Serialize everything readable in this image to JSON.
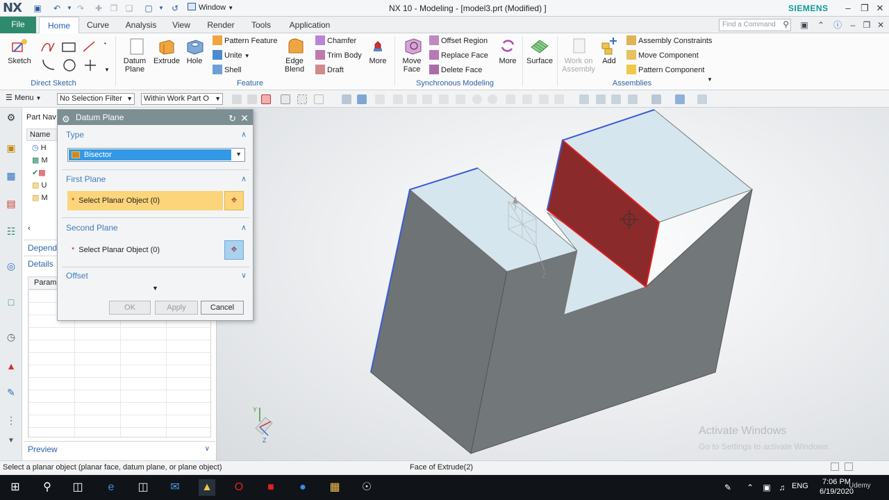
{
  "titlebar": {
    "logo": "NX",
    "window_menu": "Window",
    "title": "NX 10 - Modeling - [model3.prt (Modified) ]",
    "brand": "SIEMENS"
  },
  "tabs": {
    "file": "File",
    "items": [
      "Home",
      "Curve",
      "Analysis",
      "View",
      "Render",
      "Tools",
      "Application"
    ],
    "find_placeholder": "Find a Command"
  },
  "ribbon": {
    "direct_sketch": {
      "label": "Direct Sketch",
      "sketch": "Sketch"
    },
    "feature": {
      "label": "Feature",
      "datum_plane": "Datum Plane",
      "extrude": "Extrude",
      "hole": "Hole",
      "pattern_feature": "Pattern Feature",
      "unite": "Unite",
      "shell": "Shell",
      "edge_blend": "Edge Blend",
      "chamfer": "Chamfer",
      "trim_body": "Trim Body",
      "draft": "Draft",
      "more": "More"
    },
    "sync": {
      "label": "Synchronous Modeling",
      "move_face": "Move Face",
      "offset_region": "Offset Region",
      "replace_face": "Replace Face",
      "delete_face": "Delete Face",
      "more": "More"
    },
    "surface": "Surface",
    "assemblies": {
      "label": "Assemblies",
      "work_on_assembly": "Work on Assembly",
      "add": "Add",
      "assembly_constraints": "Assembly Constraints",
      "move_component": "Move Component",
      "pattern_component": "Pattern Component"
    }
  },
  "selbar": {
    "menu": "Menu",
    "filter": "No Selection Filter",
    "scope": "Within Work Part O"
  },
  "partnav": {
    "title": "Part Nav",
    "header": "Name",
    "rows": [
      "H",
      "M",
      "",
      "U",
      "M"
    ],
    "dependencies": "Depende",
    "details": "Details",
    "param_header": "Param",
    "preview": "Preview"
  },
  "dialog": {
    "title": "Datum Plane",
    "type_label": "Type",
    "type_value": "Bisector",
    "first_plane": "First Plane",
    "first_select": "Select Planar Object (0)",
    "second_plane": "Second Plane",
    "second_select": "Select Planar Object (0)",
    "offset": "Offset",
    "ok": "OK",
    "apply": "Apply",
    "cancel": "Cancel"
  },
  "graphics": {
    "triad_y": "Y",
    "triad_z": "Z",
    "datum_z": "Z",
    "watermark_title": "Activate Windows",
    "watermark_sub": "Go to Settings to activate Windows."
  },
  "status": {
    "prompt": "Select a planar object (planar face,  datum plane, or plane object)",
    "hint": "Face of Extrude(2)"
  },
  "taskbar": {
    "lang": "ENG",
    "time": "7:06 PM",
    "date": "6/19/2020",
    "udemy": "Udemy"
  },
  "colors": {
    "selected_face": "#8b2a2a",
    "accent_green": "#2e8a6d",
    "dialog_title": "#7c8f93",
    "highlight_yellow": "#fcd57a"
  }
}
